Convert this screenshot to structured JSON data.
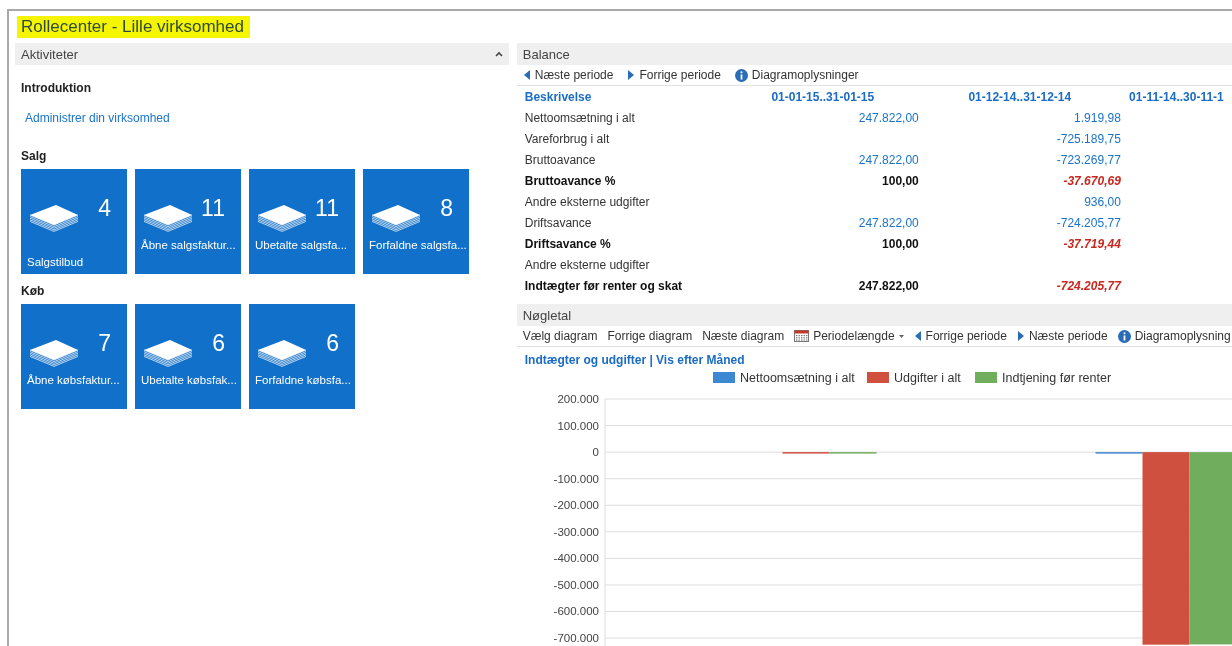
{
  "window": {
    "title": "Rollecenter - Lille virksomhed"
  },
  "activities": {
    "title": "Aktiviteter",
    "expanded": true,
    "intro": {
      "heading": "Introduktion",
      "link": "Administrer din virksomhed"
    },
    "groups": [
      {
        "heading": "Salg",
        "tiles": [
          {
            "count": "4",
            "label": "Salgstilbud"
          },
          {
            "count": "11",
            "label": "Åbne salgsfaktur..."
          },
          {
            "count": "11",
            "label": "Ubetalte salgsfa..."
          },
          {
            "count": "8",
            "label": "Forfaldne salgsfa..."
          }
        ]
      },
      {
        "heading": "Køb",
        "tiles": [
          {
            "count": "7",
            "label": "Åbne købsfaktur..."
          },
          {
            "count": "6",
            "label": "Ubetalte købsfak..."
          },
          {
            "count": "6",
            "label": "Forfaldne købsfa..."
          }
        ]
      }
    ]
  },
  "balance": {
    "title": "Balance",
    "toolbar": [
      {
        "kind": "prev",
        "label": "Næste periode"
      },
      {
        "kind": "next",
        "label": "Forrige periode"
      },
      {
        "kind": "info",
        "label": "Diagramoplysninger"
      }
    ],
    "columns": [
      "Beskrivelse",
      "01-01-15..31-01-15",
      "01-12-14..31-12-14",
      "01-11-14..30-11-1"
    ],
    "rows": [
      {
        "label": "Nettoomsætning i alt",
        "bold": false,
        "period_1": "247.822,00",
        "period_2": "1.919,98"
      },
      {
        "label": "Vareforbrug i alt",
        "bold": false,
        "period_2": "-725.189,75"
      },
      {
        "label": "Bruttoavance",
        "bold": false,
        "period_1": "247.822,00",
        "period_2": "-723.269,77"
      },
      {
        "label": "Bruttoavance %",
        "bold": true,
        "period_1": "100,00",
        "period_2": "-37.670,69",
        "red_2": true
      },
      {
        "label": "Andre eksterne udgifter",
        "bold": false,
        "period_2": "936,00"
      },
      {
        "label": "Driftsavance",
        "bold": false,
        "period_1": "247.822,00",
        "period_2": "-724.205,77"
      },
      {
        "label": "Driftsavance %",
        "bold": true,
        "period_1": "100,00",
        "period_2": "-37.719,44",
        "red_2": true
      },
      {
        "label": "Andre eksterne udgifter",
        "bold": false
      },
      {
        "label": "Indtægter før renter og skat",
        "bold": true,
        "period_1": "247.822,00",
        "period_2": "-724.205,77",
        "red_2": true
      }
    ]
  },
  "key_figures": {
    "title": "Nøgletal",
    "toolbar": [
      {
        "kind": "plain",
        "label": "Vælg diagram"
      },
      {
        "kind": "plain",
        "label": "Forrige diagram"
      },
      {
        "kind": "plain",
        "label": "Næste diagram"
      },
      {
        "kind": "calendar",
        "label": "Periodelængde"
      },
      {
        "kind": "prev",
        "label": "Forrige periode"
      },
      {
        "kind": "next",
        "label": "Næste periode"
      },
      {
        "kind": "info",
        "label": "Diagramoplysning"
      }
    ],
    "chart_title": "Indtægter og udgifter | Vis efter Måned",
    "chart_data": {
      "type": "bar",
      "stacked": false,
      "grid": true,
      "legend": true,
      "ylim": [
        -730000,
        200000
      ],
      "yticks": [
        {
          "value": 200000,
          "label": "200.000"
        },
        {
          "value": 100000,
          "label": "100.000"
        },
        {
          "value": 0,
          "label": "0"
        },
        {
          "value": -100000,
          "label": "-100.000"
        },
        {
          "value": -200000,
          "label": "-200.000"
        },
        {
          "value": -300000,
          "label": "-300.000"
        },
        {
          "value": -400000,
          "label": "-400.000"
        },
        {
          "value": -500000,
          "label": "-500.000"
        },
        {
          "value": -600000,
          "label": "-600.000"
        },
        {
          "value": -700000,
          "label": "-700.000"
        }
      ],
      "series": [
        {
          "name": "Nettoomsætning i alt",
          "color": "#3c88d3",
          "values": [
            null,
            0
          ]
        },
        {
          "name": "Udgifter i alt",
          "color": "#d05040",
          "values": [
            0,
            -725000
          ]
        },
        {
          "name": "Indtjening før renter",
          "color": "#70ad5c",
          "values": [
            0,
            -724000
          ]
        }
      ]
    }
  }
}
